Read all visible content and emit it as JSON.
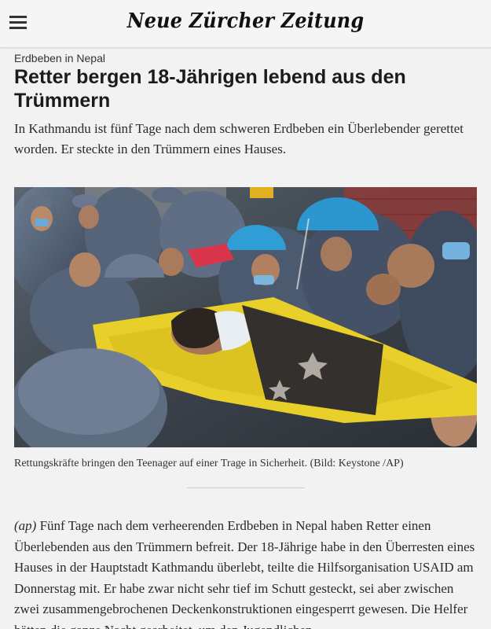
{
  "header": {
    "logo_text": "Neue Zürcher Zeitung",
    "menu_icon": "hamburger-menu-icon"
  },
  "article": {
    "kicker": "Erdbeben in Nepal",
    "headline": "Retter bergen 18-Jährigen lebend aus den Trümmern",
    "lead": "In Kathmandu ist fünf Tage nach dem schweren Erdbeben ein Überlebender gerettet worden. Er steckte in den Trümmern eines Hauses.",
    "image_caption": "Rettungskräfte bringen den Teenager auf einer Trage in Sicherheit. (Bild: Keystone /AP)",
    "body_source": "(ap)",
    "body_text": " Fünf Tage nach dem verheerenden Erdbeben in Nepal haben Retter einen Überlebenden aus den Trümmern befreit. Der 18-Jährige habe in den Überresten eines Hauses in der Hauptstadt Kathmandu überlebt, teilte die Hilfsorganisation USAID am Donnerstag mit. Er habe zwar nicht sehr tief im Schutt gesteckt, sei aber zwischen zwei zusammengebrochenen Deckenkonstruktionen eingesperrt gewesen. Die Helfer hätten die ganze Nacht gearbeitet, um den Jugendlichen"
  }
}
